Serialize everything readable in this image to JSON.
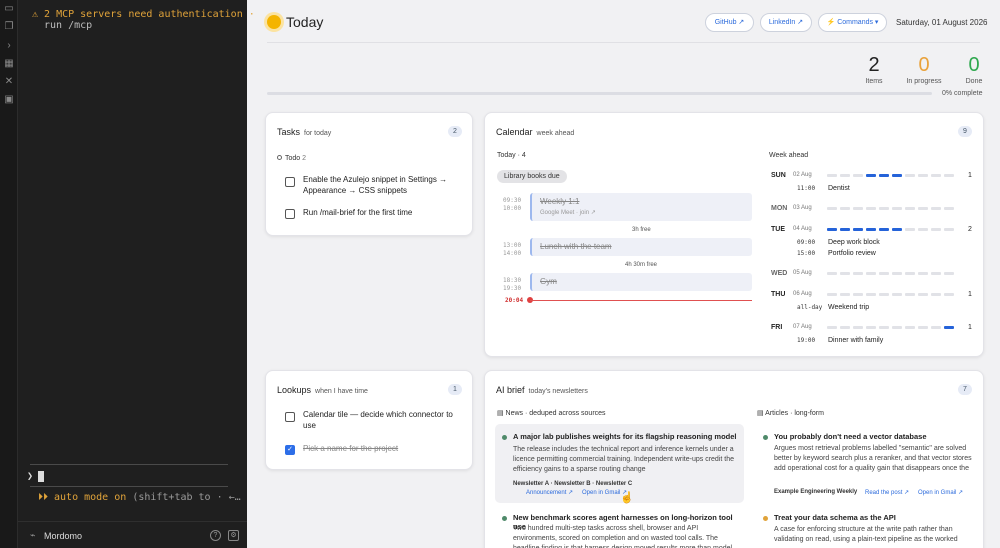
{
  "terminal": {
    "warning": "⚠ 2 MCP servers need authentication ·",
    "warning_cont": "run /mcp",
    "prompt": "❯",
    "mode_prefix": "⏵⏵ auto mode on",
    "mode_hint": "(shift+tab to · ←…",
    "footer_name": "Mordomo"
  },
  "header": {
    "title": "Today",
    "buttons": {
      "github": "GitHub ↗",
      "linkedin": "LinkedIn ↗",
      "commands": "⚡ Commands ▾"
    },
    "date": "Saturday, 01 August 2026"
  },
  "stats": [
    {
      "value": "2",
      "label": "Items",
      "color": "#222222"
    },
    {
      "value": "0",
      "label": "In progress",
      "color": "#e9a23b"
    },
    {
      "value": "0",
      "label": "Done",
      "color": "#2fa84f"
    }
  ],
  "progress": {
    "value": 0,
    "label": "0% complete"
  },
  "tasks": {
    "title": "Tasks",
    "subtitle": "for today",
    "count": "2",
    "section": "Todo",
    "section_count": "2",
    "items": [
      {
        "text": "Enable the Azulejo snippet in Settings → Appearance → CSS snippets",
        "done": false
      },
      {
        "text": "Run /mail-brief for the first time",
        "done": false
      }
    ]
  },
  "lookups": {
    "title": "Lookups",
    "subtitle": "when I have time",
    "count": "1",
    "items": [
      {
        "text": "Calendar tile — decide which connector to use",
        "done": false
      },
      {
        "text": "Pick a name for the project",
        "done": true
      }
    ]
  },
  "calendar": {
    "title": "Calendar",
    "subtitle": "week ahead",
    "count": "9",
    "today_label": "Today · 4",
    "due_pill": "Library books due",
    "events": [
      {
        "start": "09:30",
        "end": "10:00",
        "title": "Weekly 1:1",
        "sub": "Google Meet · join ↗"
      },
      {
        "start": "13:00",
        "end": "14:00",
        "title": "Lunch with the team",
        "sub": ""
      },
      {
        "start": "18:30",
        "end": "19:30",
        "title": "Gym",
        "sub": ""
      }
    ],
    "gaps": [
      "3h free",
      "4h 30m free"
    ],
    "now": "20:04",
    "week_label": "Week ahead",
    "week": [
      {
        "day": "SUN",
        "date": "02 Aug",
        "count": "1",
        "events": [
          {
            "time": "11:00",
            "title": "Dentist"
          }
        ]
      },
      {
        "day": "MON",
        "date": "03 Aug",
        "count": "",
        "events": []
      },
      {
        "day": "TUE",
        "date": "04 Aug",
        "count": "2",
        "events": [
          {
            "time": "09:00",
            "title": "Deep work block"
          },
          {
            "time": "15:00",
            "title": "Portfolio review"
          }
        ]
      },
      {
        "day": "WED",
        "date": "05 Aug",
        "count": "",
        "events": []
      },
      {
        "day": "THU",
        "date": "06 Aug",
        "count": "1",
        "events": [
          {
            "time": "all-day",
            "title": "Weekend trip"
          }
        ]
      },
      {
        "day": "FRI",
        "date": "07 Aug",
        "count": "1",
        "events": [
          {
            "time": "19:00",
            "title": "Dinner with family"
          }
        ]
      }
    ]
  },
  "brief": {
    "title": "AI brief",
    "subtitle": "today's newsletters",
    "count": "7",
    "news_label": "▤ News · deduped across sources",
    "articles_label": "▤ Articles · long-form",
    "news": [
      {
        "title": "A major lab publishes weights for its flagship reasoning model",
        "body": "The release includes the technical report and inference kernels under a licence permitting commercial training. Independent write-ups credit the efficiency gains to a sparse routing change",
        "sources": "Newsletter A · Newsletter B · Newsletter C",
        "links": [
          "Announcement ↗",
          "Open in Gmail ↗"
        ]
      },
      {
        "title": "New benchmark scores agent harnesses on long-horizon tool use",
        "body": "Two hundred multi-step tasks across shell, browser and API environments, scored on completion and on wasted tool calls. The headline finding is that harness design moved results more than model"
      }
    ],
    "articles": [
      {
        "title": "You probably don't need a vector database",
        "body": "Argues most retrieval problems labelled \"semantic\" are solved better by keyword search plus a reranker, and that vector stores add operational cost for a quality gain that disappears once the",
        "source": "Example Engineering Weekly",
        "links": [
          "Read the post ↗",
          "Open in Gmail ↗"
        ]
      },
      {
        "title": "Treat your data schema as the API",
        "body": "A case for enforcing structure at the write path rather than validating on read, using a plain-text pipeline as the worked"
      }
    ]
  }
}
